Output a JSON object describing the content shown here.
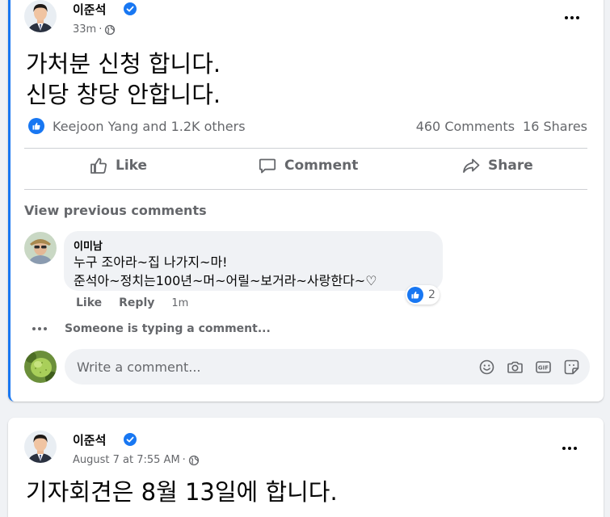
{
  "posts": [
    {
      "author": "이준석",
      "timestamp": "33m",
      "audience_icon": "globe-icon",
      "text_lines": [
        "가처분 신청 합니다.",
        "신당 창당 안합니다."
      ],
      "reactions": {
        "summary": "Keejoon Yang and 1.2K others",
        "comments": "460 Comments",
        "shares": "16 Shares"
      },
      "actions": {
        "like": "Like",
        "comment": "Comment",
        "share": "Share"
      },
      "view_previous": "View previous comments",
      "comment": {
        "author": "이미남",
        "lines": [
          "누구 조아라~집 나가지~마!",
          "준석아~정치는100년~머~어릴~보거라~사랑한다~♡"
        ],
        "reaction_count": "2",
        "like_label": "Like",
        "reply_label": "Reply",
        "time": "1m"
      },
      "typing": "Someone is typing a comment...",
      "write_placeholder": "Write a comment...",
      "composer_icons": [
        "emoji-icon",
        "camera-icon",
        "gif-icon",
        "sticker-icon"
      ]
    },
    {
      "author": "이준석",
      "timestamp": "August 7 at 7:55 AM",
      "audience_icon": "globe-icon",
      "text_lines": [
        "기자회견은 8월 13일에 합니다."
      ]
    }
  ],
  "colors": {
    "accent": "#1877f2",
    "secondary_text": "#65676b",
    "background": "#f0f2f5"
  }
}
